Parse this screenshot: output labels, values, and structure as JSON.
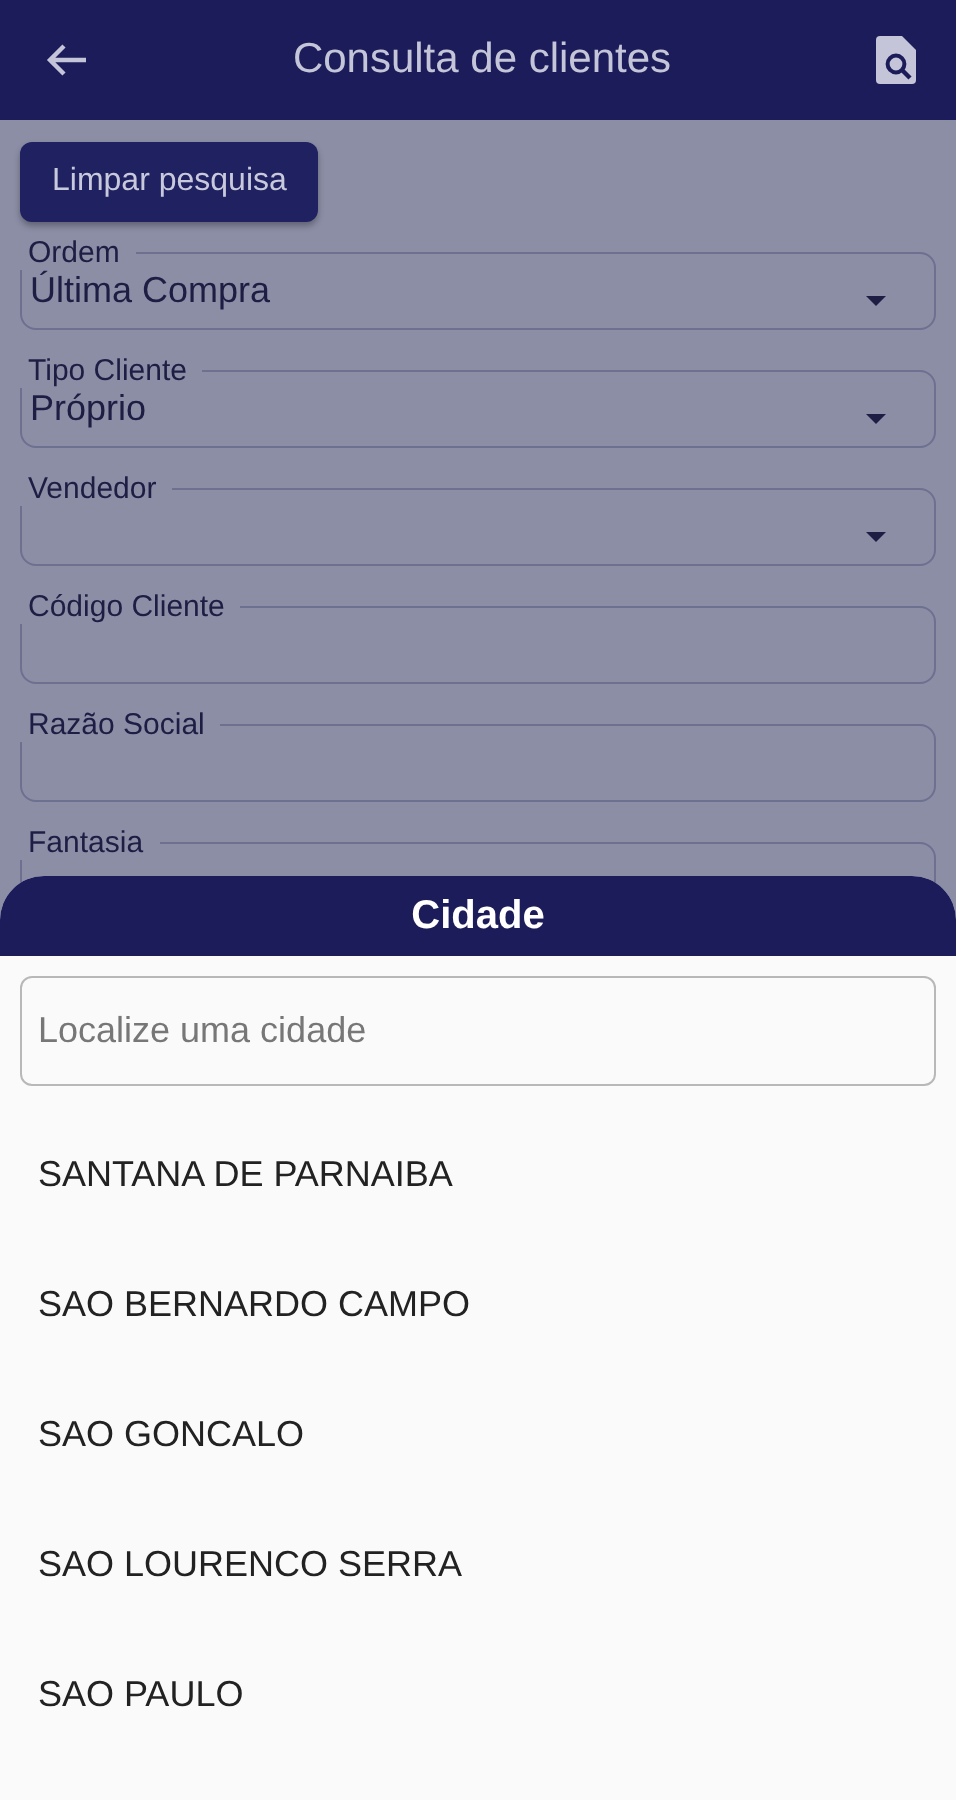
{
  "app_bar": {
    "title": "Consulta de clientes"
  },
  "clear_button": "Limpar pesquisa",
  "fields": [
    {
      "kind": "select",
      "label": "Ordem",
      "value": "Última Compra"
    },
    {
      "kind": "select",
      "label": "Tipo Cliente",
      "value": "Próprio"
    },
    {
      "kind": "select",
      "label": "Vendedor"
    },
    {
      "kind": "text",
      "label": "Código Cliente"
    },
    {
      "kind": "text",
      "label": "Razão Social"
    },
    {
      "kind": "text",
      "label": "Fantasia"
    }
  ],
  "sheet": {
    "title": "Cidade",
    "search": {
      "placeholder": "Localize uma cidade"
    },
    "cities": [
      "SANTANA DE PARNAIBA",
      "SAO BERNARDO CAMPO",
      "SAO GONCALO",
      "SAO LOURENCO SERRA",
      "SAO PAULO"
    ]
  }
}
